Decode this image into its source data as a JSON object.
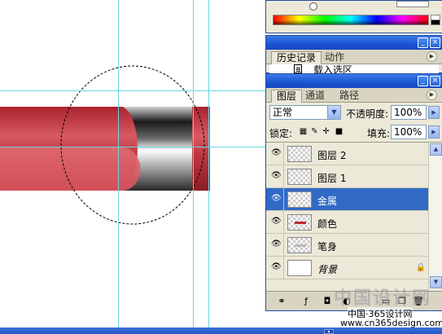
{
  "history_panel": {
    "tabs": [
      "历史记录",
      "动作"
    ],
    "item": "载入选区"
  },
  "layers_panel": {
    "tabs": [
      "图层",
      "通道",
      "路径"
    ],
    "blend_mode": "正常",
    "opacity_label": "不透明度:",
    "opacity_value": "100%",
    "lock_label": "锁定:",
    "fill_label": "填充:",
    "fill_value": "100%",
    "layers": [
      {
        "name": "图层 2",
        "selected": false
      },
      {
        "name": "图层 1",
        "selected": false
      },
      {
        "name": "金属",
        "selected": true
      },
      {
        "name": "颜色",
        "selected": false
      },
      {
        "name": "笔身",
        "selected": false
      },
      {
        "name": "背景",
        "selected": false
      }
    ]
  },
  "watermark": {
    "big": "中国设计网",
    "line1": "中国·365设计网",
    "line2": "www.cn365design.com"
  },
  "colors": {
    "pen_red": "#c43a44",
    "selection_blue": "#316ac5",
    "guide": "#67d6e2",
    "titlebar": "#1b53d2"
  }
}
